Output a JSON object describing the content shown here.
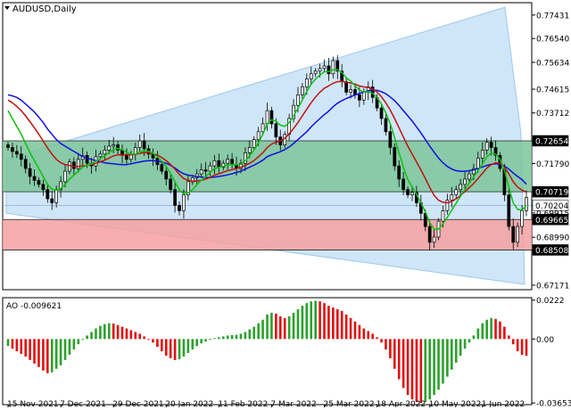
{
  "symbol": {
    "title": "AUDUSD,Daily"
  },
  "chart_data": [
    {
      "type": "candlestick",
      "title": "AUDUSD,Daily",
      "ylim": [
        0.67,
        0.779
      ],
      "y_ticks": [
        "0.77431",
        "0.76540",
        "0.75634",
        "0.74615",
        "0.73712",
        "0.72654",
        "0.71790",
        "0.70719",
        "0.70204",
        "0.69915",
        "0.69665",
        "0.68990",
        "0.68508",
        "0.67171"
      ],
      "y_tick_values": [
        0.77431,
        0.7654,
        0.75634,
        0.74615,
        0.73712,
        0.72654,
        0.7179,
        0.70719,
        0.70204,
        0.69915,
        0.69665,
        0.6899,
        0.68508,
        0.67171
      ],
      "highlighted_levels": [
        {
          "value": 0.72654,
          "label": "0.72654",
          "color": "#000000"
        },
        {
          "value": 0.70719,
          "label": "0.70719",
          "color": "#000000"
        },
        {
          "value": 0.70204,
          "label": "0.70204",
          "color": "#ffffff"
        },
        {
          "value": 0.69665,
          "label": "0.69665",
          "color": "#000000"
        },
        {
          "value": 0.68508,
          "label": "0.68508",
          "color": "#000000"
        }
      ],
      "x_ticks": [
        "15 Nov 2021",
        "7 Dec 2021",
        "29 Dec 2021",
        "20 Jan 2022",
        "11 Feb 2022",
        "7 Mar 2022",
        "25 Mar 2022",
        "18 Apr 2022",
        "10 May 2022",
        "1 Jun 2022"
      ],
      "zones": [
        {
          "name": "green",
          "from": 0.70719,
          "to": 0.72654,
          "color": "#7cc49a"
        },
        {
          "name": "red",
          "from": 0.68508,
          "to": 0.69665,
          "color": "#f4a0a0"
        }
      ],
      "close": [
        0.724,
        0.7225,
        0.7215,
        0.7195,
        0.716,
        0.713,
        0.7115,
        0.71,
        0.708,
        0.7045,
        0.703,
        0.708,
        0.711,
        0.715,
        0.7185,
        0.716,
        0.7195,
        0.721,
        0.718,
        0.717,
        0.7205,
        0.7215,
        0.723,
        0.7245,
        0.725,
        0.723,
        0.721,
        0.7195,
        0.7215,
        0.724,
        0.7265,
        0.7235,
        0.7215,
        0.72,
        0.7175,
        0.715,
        0.712,
        0.708,
        0.702,
        0.7,
        0.706,
        0.711,
        0.7125,
        0.714,
        0.7155,
        0.715,
        0.717,
        0.719,
        0.7165,
        0.718,
        0.7195,
        0.7175,
        0.716,
        0.718,
        0.722,
        0.724,
        0.727,
        0.73,
        0.733,
        0.738,
        0.733,
        0.728,
        0.725,
        0.729,
        0.735,
        0.74,
        0.744,
        0.747,
        0.75,
        0.752,
        0.753,
        0.754,
        0.755,
        0.752,
        0.757,
        0.753,
        0.749,
        0.745,
        0.746,
        0.744,
        0.742,
        0.745,
        0.747,
        0.743,
        0.739,
        0.735,
        0.73,
        0.724,
        0.717,
        0.712,
        0.708,
        0.706,
        0.707,
        0.703,
        0.699,
        0.694,
        0.688,
        0.69,
        0.696,
        0.7,
        0.704,
        0.706,
        0.708,
        0.71,
        0.712,
        0.714,
        0.716,
        0.72,
        0.723,
        0.726,
        0.724,
        0.721,
        0.716,
        0.706,
        0.694,
        0.688,
        0.694,
        0.7,
        0.705
      ],
      "series": [
        {
          "name": "MA blue",
          "color": "#1010e0",
          "values": [
            0.744,
            0.7436,
            0.743,
            0.742,
            0.7405,
            0.739,
            0.7375,
            0.7355,
            0.7335,
            0.731,
            0.729,
            0.727,
            0.7255,
            0.7245,
            0.7235,
            0.7225,
            0.7215,
            0.7205,
            0.72,
            0.7195,
            0.719,
            0.7186,
            0.7182,
            0.718,
            0.7178,
            0.7176,
            0.7175,
            0.7175,
            0.7178,
            0.7182,
            0.7185,
            0.7188,
            0.719,
            0.719,
            0.7188,
            0.7185,
            0.718,
            0.7172,
            0.7162,
            0.715,
            0.714,
            0.7135,
            0.7132,
            0.713,
            0.7128,
            0.7126,
            0.7126,
            0.7128,
            0.713,
            0.7133,
            0.7136,
            0.714,
            0.7145,
            0.715,
            0.7158,
            0.7165,
            0.7173,
            0.7182,
            0.7192,
            0.7205,
            0.7212,
            0.7218,
            0.7224,
            0.7232,
            0.7242,
            0.7255,
            0.727,
            0.7285,
            0.73,
            0.7318,
            0.7335,
            0.735,
            0.7365,
            0.7378,
            0.7395,
            0.7408,
            0.7418,
            0.7426,
            0.7433,
            0.744,
            0.7445,
            0.745,
            0.7456,
            0.7458,
            0.7457,
            0.7452,
            0.7444,
            0.7432,
            0.7418,
            0.74,
            0.738,
            0.736,
            0.734,
            0.7318,
            0.7295,
            0.727,
            0.7245,
            0.7222,
            0.72,
            0.7182,
            0.7168,
            0.7158,
            0.7152,
            0.715,
            0.715,
            0.7152,
            0.7155,
            0.716,
            0.7166,
            0.7172,
            0.7176,
            0.7178,
            0.7176,
            0.717,
            0.7158,
            0.7143,
            0.713,
            0.7118,
            0.71
          ]
        },
        {
          "name": "MA red",
          "color": "#c01010",
          "values": [
            0.742,
            0.741,
            0.7396,
            0.738,
            0.736,
            0.7338,
            0.7315,
            0.729,
            0.7265,
            0.7238,
            0.7215,
            0.7195,
            0.7182,
            0.7175,
            0.7172,
            0.7168,
            0.7168,
            0.717,
            0.7172,
            0.7175,
            0.718,
            0.7186,
            0.7192,
            0.72,
            0.7208,
            0.7212,
            0.7213,
            0.7212,
            0.7212,
            0.7214,
            0.7218,
            0.722,
            0.722,
            0.7217,
            0.7211,
            0.7202,
            0.719,
            0.7175,
            0.7158,
            0.7138,
            0.7122,
            0.7115,
            0.7112,
            0.7112,
            0.7115,
            0.712,
            0.7127,
            0.7135,
            0.714,
            0.7146,
            0.7152,
            0.7156,
            0.716,
            0.7165,
            0.7172,
            0.718,
            0.719,
            0.7205,
            0.722,
            0.724,
            0.7253,
            0.726,
            0.7265,
            0.7275,
            0.7292,
            0.7312,
            0.7335,
            0.736,
            0.7385,
            0.741,
            0.7432,
            0.745,
            0.7465,
            0.7474,
            0.7484,
            0.749,
            0.7491,
            0.7488,
            0.7485,
            0.748,
            0.7474,
            0.747,
            0.7468,
            0.7462,
            0.745,
            0.7433,
            0.741,
            0.7382,
            0.735,
            0.7315,
            0.728,
            0.7245,
            0.7215,
            0.7185,
            0.7155,
            0.7122,
            0.7088,
            0.7058,
            0.704,
            0.7032,
            0.703,
            0.7035,
            0.7045,
            0.7058,
            0.7072,
            0.7088,
            0.7103,
            0.7122,
            0.7142,
            0.7162,
            0.7175,
            0.7182,
            0.718,
            0.7165,
            0.714,
            0.711,
            0.709,
            0.7078,
            0.707
          ]
        },
        {
          "name": "MA green",
          "color": "#10c010",
          "values": [
            0.738,
            0.735,
            0.732,
            0.729,
            0.7255,
            0.722,
            0.719,
            0.716,
            0.713,
            0.71,
            0.7082,
            0.7078,
            0.7085,
            0.71,
            0.712,
            0.7135,
            0.715,
            0.7165,
            0.7172,
            0.7178,
            0.7188,
            0.7198,
            0.7208,
            0.722,
            0.7232,
            0.7236,
            0.7232,
            0.7222,
            0.7215,
            0.7215,
            0.7222,
            0.7228,
            0.7226,
            0.7218,
            0.7205,
            0.7188,
            0.7168,
            0.7142,
            0.711,
            0.7078,
            0.7065,
            0.7068,
            0.708,
            0.7098,
            0.7115,
            0.713,
            0.7145,
            0.716,
            0.7164,
            0.7168,
            0.7174,
            0.7176,
            0.7174,
            0.7176,
            0.719,
            0.7208,
            0.723,
            0.7258,
            0.729,
            0.733,
            0.7345,
            0.734,
            0.7325,
            0.732,
            0.7335,
            0.736,
            0.739,
            0.742,
            0.7452,
            0.748,
            0.75,
            0.7515,
            0.7528,
            0.7528,
            0.7535,
            0.7535,
            0.7525,
            0.7505,
            0.7492,
            0.7475,
            0.7458,
            0.745,
            0.7452,
            0.7446,
            0.743,
            0.7405,
            0.7372,
            0.733,
            0.7278,
            0.722,
            0.7165,
            0.7118,
            0.709,
            0.7062,
            0.703,
            0.6995,
            0.6955,
            0.693,
            0.693,
            0.695,
            0.6975,
            0.7002,
            0.7028,
            0.7055,
            0.708,
            0.7105,
            0.7128,
            0.7152,
            0.7178,
            0.7205,
            0.7218,
            0.7215,
            0.7195,
            0.7155,
            0.709,
            0.703,
            0.7005,
            0.7002,
            0.702
          ]
        }
      ]
    },
    {
      "type": "bar",
      "title": "AO -0.009621",
      "ylim": [
        -0.0375,
        0.0236
      ],
      "y_ticks": [
        "0.0222",
        "0.00",
        "-0.036533"
      ],
      "y_tick_values": [
        0.0222,
        0.0,
        -0.036533
      ],
      "colors": {
        "up": "#2ca02c",
        "down": "#e01010"
      },
      "values": [
        -0.004,
        -0.0055,
        -0.007,
        -0.0085,
        -0.01,
        -0.012,
        -0.014,
        -0.016,
        -0.018,
        -0.0195,
        -0.019,
        -0.017,
        -0.015,
        -0.012,
        -0.009,
        -0.006,
        -0.003,
        0.0,
        0.002,
        0.004,
        0.006,
        0.0075,
        0.0085,
        0.009,
        0.0088,
        0.008,
        0.007,
        0.006,
        0.005,
        0.004,
        0.003,
        0.0015,
        0.0,
        -0.002,
        -0.0045,
        -0.007,
        -0.0095,
        -0.011,
        -0.012,
        -0.0115,
        -0.01,
        -0.008,
        -0.006,
        -0.004,
        -0.0025,
        -0.0015,
        -0.0005,
        0.0005,
        0.001,
        0.0015,
        0.002,
        0.0022,
        0.0024,
        0.003,
        0.004,
        0.0055,
        0.007,
        0.009,
        0.011,
        0.014,
        0.015,
        0.0145,
        0.013,
        0.012,
        0.013,
        0.015,
        0.017,
        0.019,
        0.0205,
        0.0215,
        0.0218,
        0.0215,
        0.0205,
        0.019,
        0.018,
        0.017,
        0.016,
        0.014,
        0.012,
        0.01,
        0.008,
        0.006,
        0.0045,
        0.003,
        0.001,
        -0.002,
        -0.006,
        -0.011,
        -0.017,
        -0.023,
        -0.028,
        -0.032,
        -0.0345,
        -0.036,
        -0.0365,
        -0.036,
        -0.0345,
        -0.032,
        -0.029,
        -0.0255,
        -0.0215,
        -0.0175,
        -0.0135,
        -0.0095,
        -0.0055,
        -0.002,
        0.002,
        0.006,
        0.009,
        0.011,
        0.012,
        0.0115,
        0.01,
        0.007,
        0.002,
        -0.003,
        -0.007,
        -0.009,
        -0.0096
      ]
    }
  ]
}
